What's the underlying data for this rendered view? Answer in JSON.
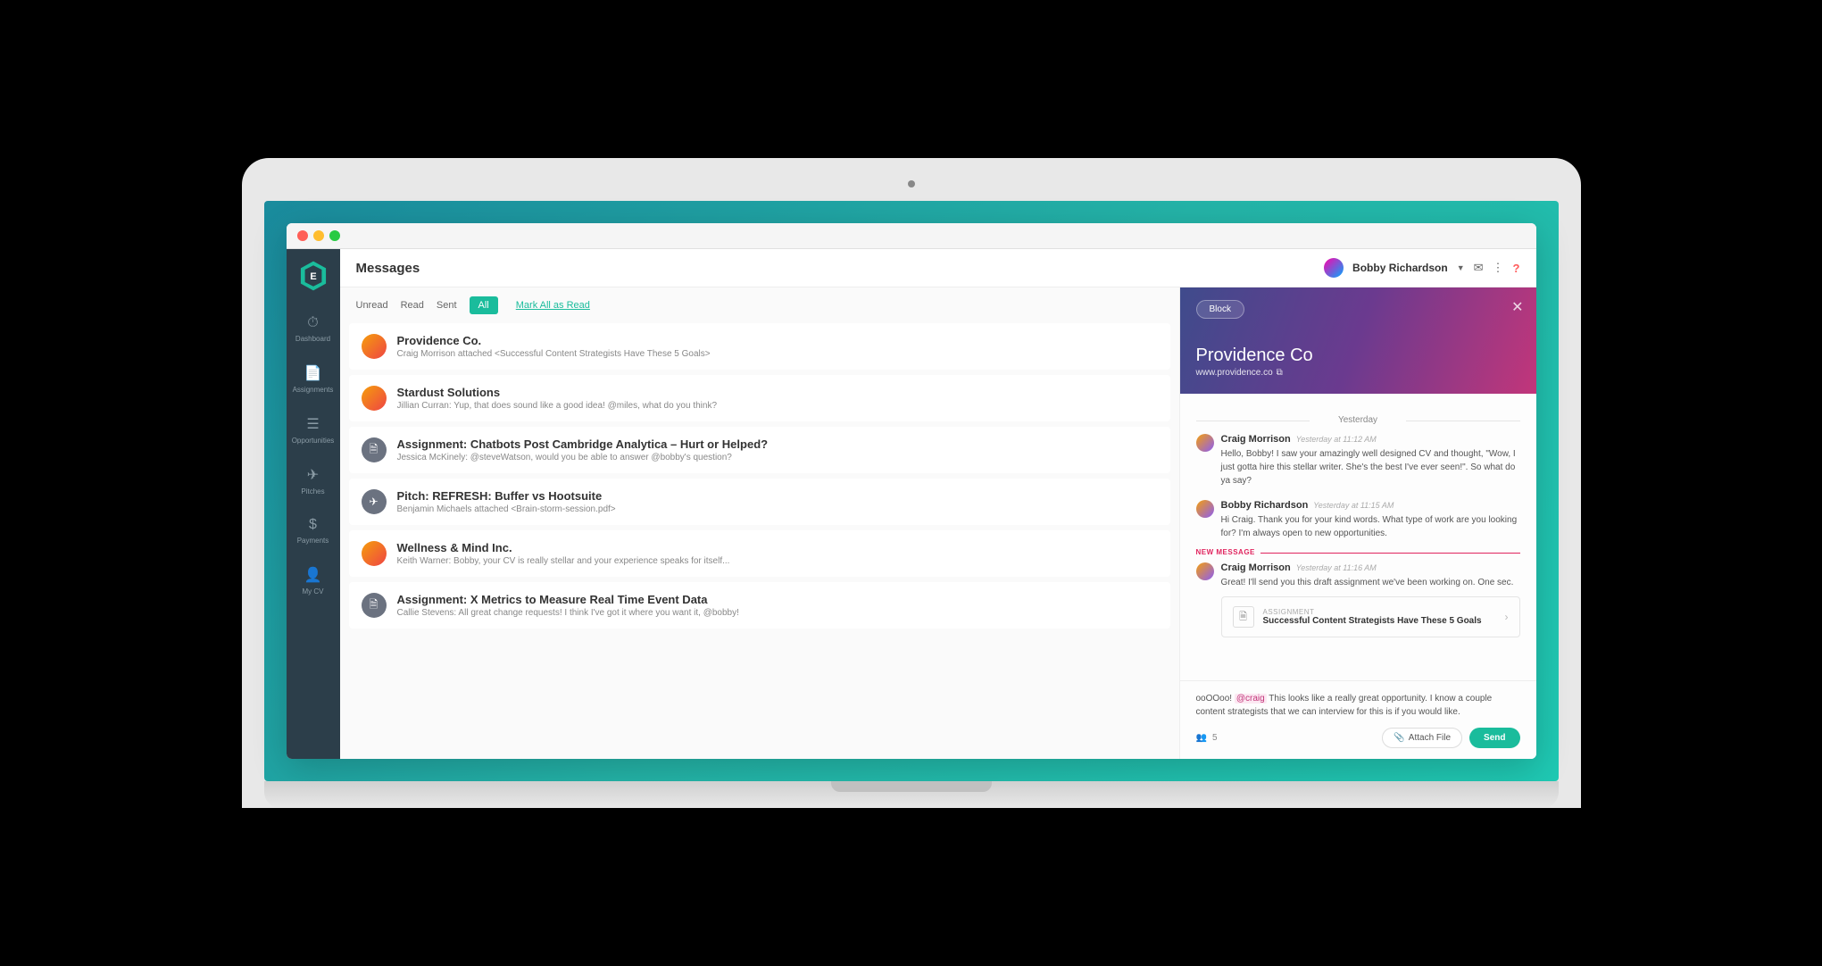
{
  "pageTitle": "Messages",
  "user": {
    "name": "Bobby Richardson"
  },
  "sidebar": {
    "items": [
      {
        "label": "Dashboard"
      },
      {
        "label": "Assignments"
      },
      {
        "label": "Opportunities"
      },
      {
        "label": "Pitches"
      },
      {
        "label": "Payments"
      },
      {
        "label": "My CV"
      }
    ]
  },
  "filters": {
    "unread": "Unread",
    "read": "Read",
    "sent": "Sent",
    "all": "All",
    "markAll": "Mark All as Read"
  },
  "threads": [
    {
      "title": "Providence Co.",
      "preview": "Craig Morrison attached <Successful Content Strategists Have These 5 Goals>",
      "type": "avatar"
    },
    {
      "title": "Stardust Solutions",
      "preview": "Jillian Curran: Yup, that does sound like a good idea! @miles, what do you think?",
      "type": "avatar"
    },
    {
      "title": "Assignment: Chatbots Post Cambridge Analytica – Hurt or Helped?",
      "preview": "Jessica McKinely: @steveWatson, would you be able to answer @bobby's question?",
      "type": "doc"
    },
    {
      "title": "Pitch: REFRESH: Buffer vs Hootsuite",
      "preview": "Benjamin Michaels attached <Brain-storm-session.pdf>",
      "type": "pitch"
    },
    {
      "title": "Wellness & Mind Inc.",
      "preview": "Keith Warner: Bobby, your CV is really stellar and your experience speaks for itself...",
      "type": "avatar"
    },
    {
      "title": "Assignment: X Metrics to Measure Real Time Event Data",
      "preview": "Callie Stevens: All great change requests! I think I've got it where you want it, @bobby!",
      "type": "doc"
    }
  ],
  "detail": {
    "block": "Block",
    "company": "Providence Co",
    "url": "www.providence.co",
    "daySeparator": "Yesterday",
    "newMessageLabel": "NEW MESSAGE",
    "messages": [
      {
        "author": "Craig Morrison",
        "time": "Yesterday at 11:12 AM",
        "text": "Hello, Bobby! I saw your amazingly well designed CV and thought, \"Wow, I just gotta hire this stellar writer. She's the best I've ever seen!\". So what do ya say?"
      },
      {
        "author": "Bobby Richardson",
        "time": "Yesterday at 11:15 AM",
        "text": "Hi Craig. Thank you for your kind words. What type of work are you looking for? I'm always open to new opportunities."
      },
      {
        "author": "Craig Morrison",
        "time": "Yesterday at 11:16 AM",
        "text": "Great! I'll send you this draft assignment we've been working on. One sec."
      }
    ],
    "attachment": {
      "label": "ASSIGNMENT",
      "title": "Successful Content Strategists Have These 5 Goals"
    },
    "compose": {
      "prefix": "ooOOoo! ",
      "mention": "@craig",
      "rest": " This looks like a really great opportunity. I know a couple content strategists that we can interview for this is if you would like.",
      "ccCount": "5",
      "attach": "Attach File",
      "send": "Send"
    }
  }
}
